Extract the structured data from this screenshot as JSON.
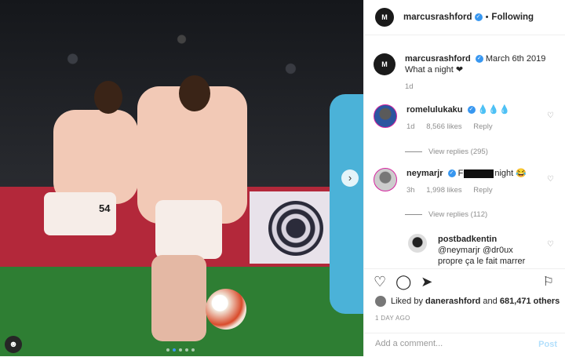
{
  "header": {
    "username": "marcusrashford",
    "separator": "•",
    "follow_status": "Following",
    "avatar_initials": "M"
  },
  "photo": {
    "kit_number": "54",
    "next_arrow": "›",
    "slide_count": 5,
    "active_slide": 1
  },
  "caption": {
    "username": "marcusrashford",
    "date": "March 6th 2019",
    "text": "What a night ❤",
    "age": "1d"
  },
  "comments": [
    {
      "username": "romelulukaku",
      "text": "💧💧💧",
      "age": "1d",
      "likes": "8,566 likes",
      "reply": "Reply",
      "view_replies": "View replies (295)"
    },
    {
      "username": "neymarjr",
      "text_before": "F",
      "text_after": "night 😂 ",
      "age": "3h",
      "likes": "1,998 likes",
      "reply": "Reply",
      "view_replies": "View replies (112)"
    },
    {
      "username": "postbadkentin",
      "line1": "@neymarjr @dr0ux",
      "line2": "propre ça le fait marrer"
    }
  ],
  "actions": {
    "liked_by_prefix": "Liked by",
    "liked_by_user": "danerashford",
    "liked_by_and": "and",
    "liked_by_count": "681,471 others",
    "date_label": "1 DAY AGO"
  },
  "add_comment": {
    "placeholder": "Add a comment...",
    "post_label": "Post"
  }
}
